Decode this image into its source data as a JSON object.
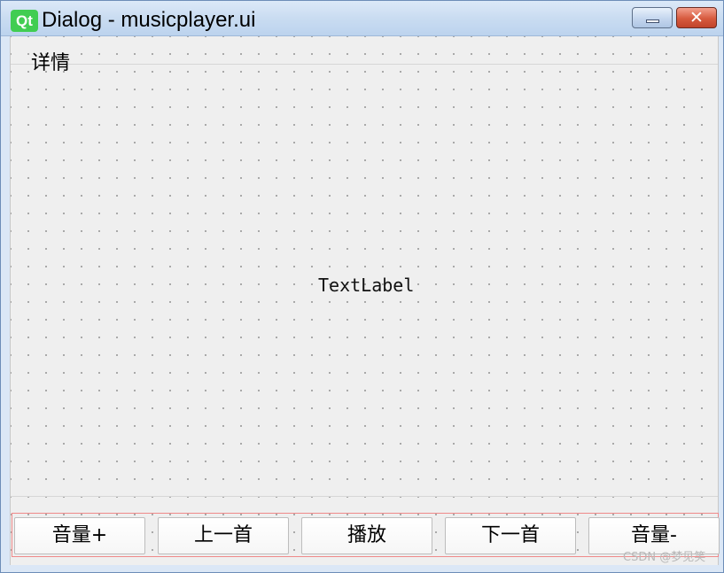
{
  "window": {
    "logo": "Qt",
    "title": "Dialog - musicplayer.ui",
    "minimize_icon": "minimize-icon",
    "close_symbol": "✕"
  },
  "detail": {
    "label": "详情"
  },
  "content": {
    "text_label": "TextLabel"
  },
  "controls": {
    "buttons": [
      "音量+",
      "上一首",
      "播放",
      "下一首",
      "音量-"
    ]
  },
  "watermark": {
    "text": "CSDN @梦见笑"
  },
  "colors": {
    "qt_green": "#41cd52",
    "close_red": "#d65a3e",
    "layout_outline": "#ef8a8a",
    "form_background": "#efefef"
  }
}
